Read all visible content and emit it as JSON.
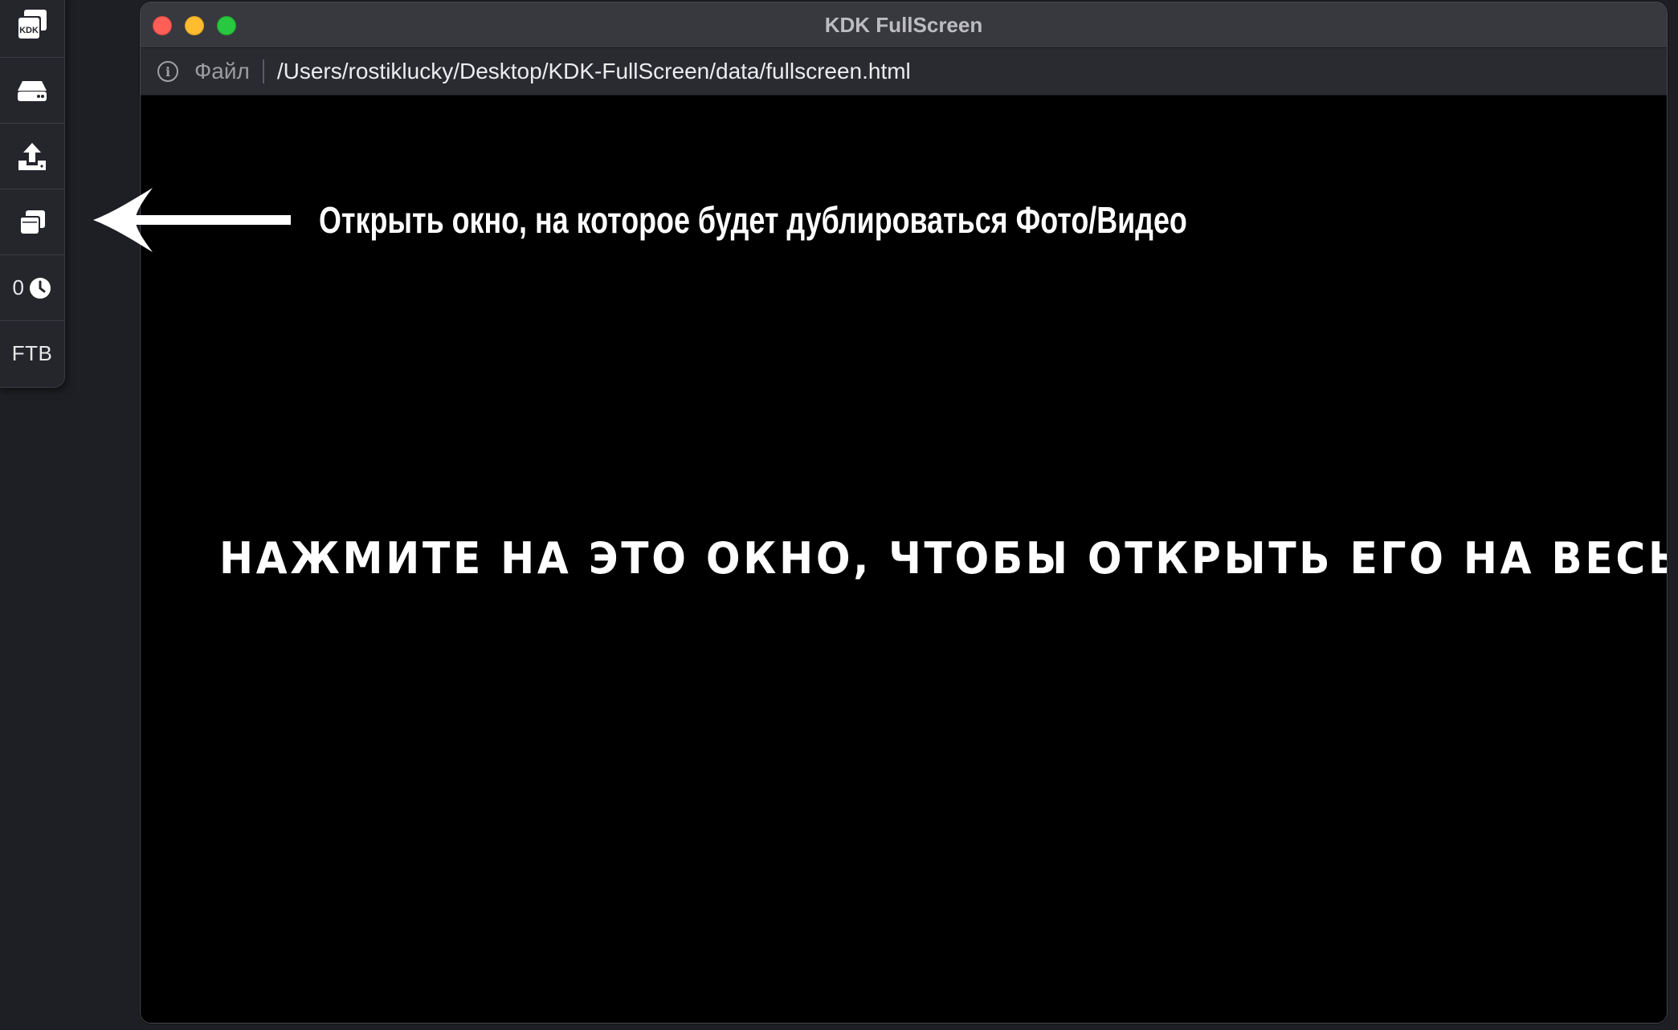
{
  "toolbar": {
    "items": [
      {
        "name": "kdk-logo",
        "icon": "kdk-windows-icon",
        "label": "KDK"
      },
      {
        "name": "drive",
        "icon": "hard-drive-icon"
      },
      {
        "name": "upload",
        "icon": "upload-icon"
      },
      {
        "name": "windows",
        "icon": "windows-stack-icon"
      },
      {
        "name": "timer",
        "icon": "clock-icon",
        "value": "0"
      },
      {
        "name": "ftb",
        "label": "FTB"
      }
    ]
  },
  "window": {
    "title": "KDK FullScreen",
    "address": {
      "scheme_label": "Файл",
      "url": "/Users/rostiklucky/Desktop/KDK-FullScreen/data/fullscreen.html"
    },
    "hint": "Открыть окно, на которое будет дублироваться Фото/Видео",
    "main_message": "НАЖМИТЕ НА ЭТО ОКНО, ЧТОБЫ ОТКРЫТЬ ЕГО НА ВЕСЬ ЭКРАН"
  },
  "colors": {
    "background": "#1e1f24",
    "toolbar": "#25262c",
    "content": "#000000",
    "close": "#ff5f57",
    "minimize": "#febc2e",
    "maximize": "#28c840"
  }
}
